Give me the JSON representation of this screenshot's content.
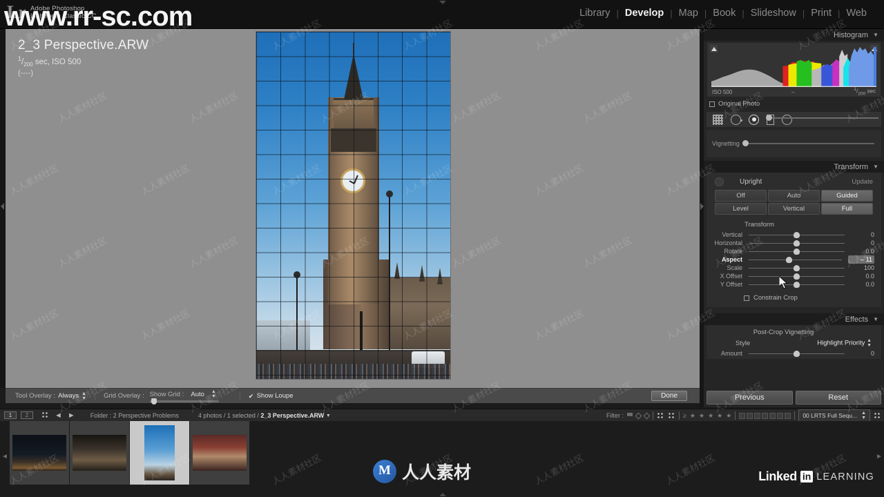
{
  "app": {
    "logo": "Lr",
    "brand_line1": "Adobe Photoshop",
    "brand_line2": "Lightroom Classic CC"
  },
  "modules": [
    {
      "label": "Library",
      "active": false
    },
    {
      "label": "Develop",
      "active": true
    },
    {
      "label": "Map",
      "active": false
    },
    {
      "label": "Book",
      "active": false
    },
    {
      "label": "Slideshow",
      "active": false
    },
    {
      "label": "Print",
      "active": false
    },
    {
      "label": "Web",
      "active": false
    }
  ],
  "photo_info": {
    "filename": "2_3 Perspective.ARW",
    "shutter_num": "1",
    "shutter_den": "200",
    "exposure_rest": " sec, ISO 500",
    "dashes": "(----)"
  },
  "toolbar": {
    "tool_overlay_label": "Tool Overlay :",
    "tool_overlay_value": "Always",
    "grid_overlay_label": "Grid Overlay :",
    "show_grid_label": "Show Grid :",
    "show_grid_value": "Auto",
    "show_loupe_label": "Show Loupe",
    "show_loupe_checked": true,
    "done_label": "Done"
  },
  "histogram": {
    "title": "Histogram",
    "iso_label": "ISO 500",
    "dash": "–",
    "shutter_num": "1",
    "shutter_den": "200",
    "shutter_unit": " sec",
    "original_photo_label": "Original Photo"
  },
  "tools": [
    {
      "name": "crop-overlay-tool",
      "active": false
    },
    {
      "name": "spot-removal-tool",
      "active": false
    },
    {
      "name": "red-eye-tool",
      "active": true
    },
    {
      "name": "graduated-filter-tool",
      "active": false
    },
    {
      "name": "radial-filter-tool",
      "active": false
    }
  ],
  "vignetting_strip": {
    "label": "Vignetting",
    "value": 0
  },
  "transform": {
    "title": "Transform",
    "upright_label": "Upright",
    "update_label": "Update",
    "buttons_row1": [
      {
        "label": "Off",
        "selected": false
      },
      {
        "label": "Auto",
        "selected": false
      },
      {
        "label": "Guided",
        "selected": true
      }
    ],
    "buttons_row2": [
      {
        "label": "Level",
        "selected": false
      },
      {
        "label": "Vertical",
        "selected": false
      },
      {
        "label": "Full",
        "selected": true
      }
    ],
    "section_label": "Transform",
    "sliders": [
      {
        "label": "Vertical",
        "value": "0",
        "pos": 50,
        "active": false
      },
      {
        "label": "Horizontal",
        "value": "0",
        "pos": 50,
        "active": false
      },
      {
        "label": "Rotate",
        "value": "0.0",
        "pos": 50,
        "active": false
      },
      {
        "label": "Aspect",
        "value": "– 11",
        "pos": 43,
        "active": true
      },
      {
        "label": "Scale",
        "value": "100",
        "pos": 50,
        "active": false
      },
      {
        "label": "X Offset",
        "value": "0.0",
        "pos": 50,
        "active": false
      },
      {
        "label": "Y Offset",
        "value": "0.0",
        "pos": 50,
        "active": false
      }
    ],
    "constrain_crop_label": "Constrain Crop",
    "constrain_crop_checked": false
  },
  "effects": {
    "title": "Effects",
    "post_crop_vignetting_label": "Post-Crop Vignetting",
    "style_label": "Style",
    "style_value": "Highlight Priority",
    "amount_label": "Amount",
    "amount_value": "0"
  },
  "panel_buttons": {
    "previous": "Previous",
    "reset": "Reset"
  },
  "filmstrip_bar": {
    "num1": "1",
    "num2": "2",
    "back_arrow": "◄",
    "forward_arrow": "►",
    "folder_label": "Folder : 2 Perspective Problems",
    "count_text": "4 photos / 1 selected / ",
    "current_file": "2_3 Perspective.ARW",
    "filter_label": "Filter :",
    "source_label": "00 LRTS Full Sequ..."
  },
  "filmstrip": {
    "thumbnails": [
      {
        "name": "thumb-night-skyline",
        "selected": false
      },
      {
        "name": "thumb-night-street",
        "selected": false
      },
      {
        "name": "thumb-big-ben",
        "selected": true
      },
      {
        "name": "thumb-red-interior",
        "selected": false
      }
    ]
  },
  "watermarks": {
    "url": "www.rr-sc.com",
    "tile": "人人素材社区",
    "center": "人人素材",
    "linkedin_word": "Linked",
    "linkedin_in": "in",
    "linkedin_learning": "LEARNING"
  }
}
